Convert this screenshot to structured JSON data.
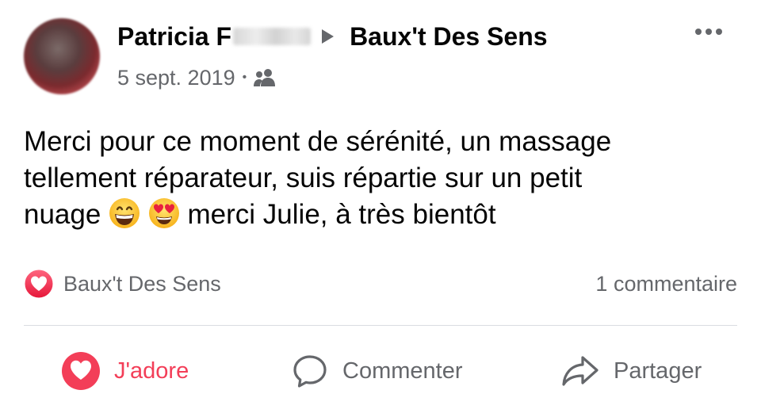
{
  "post": {
    "author_name": "Patricia F",
    "target_page": "Baux't Des Sens",
    "date": "5 sept. 2019",
    "separator": "•",
    "audience_icon": "friends-icon",
    "text_line1": "Merci pour ce moment de sérénité, un massage",
    "text_line2": "tellement réparateur, suis répartie sur un petit",
    "text_line3_before": "nuage",
    "text_line3_after": "merci Julie, à très bientôt",
    "emojis": [
      "grinning-face-emoji",
      "heart-eyes-emoji"
    ]
  },
  "reactions": {
    "icon": "love-reaction-icon",
    "by": "Baux't Des Sens",
    "comments_count": "1 commentaire"
  },
  "actions": {
    "like_label": "J'adore",
    "comment_label": "Commenter",
    "share_label": "Partager"
  },
  "colors": {
    "love_red": "#f33e58",
    "secondary_text": "#65676b",
    "primary_text": "#050505",
    "divider": "#dadde1"
  }
}
